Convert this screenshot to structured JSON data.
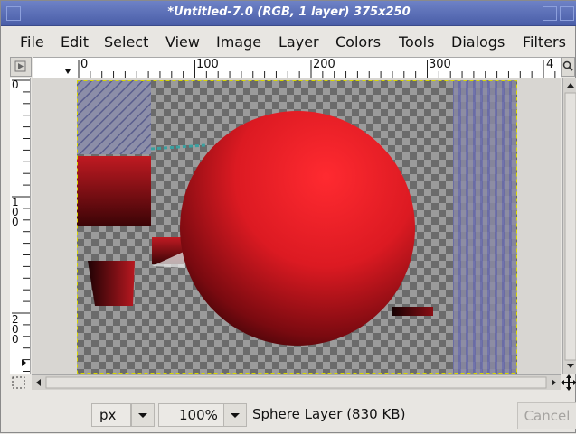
{
  "window": {
    "title": "*Untitled-7.0 (RGB, 1 layer) 375x250"
  },
  "menu": [
    "File",
    "Edit",
    "Select",
    "View",
    "Image",
    "Layer",
    "Colors",
    "Tools",
    "Dialogs",
    "Filters"
  ],
  "ruler": {
    "top_labels": [
      "0",
      "100",
      "200",
      "300",
      "4"
    ],
    "left_labels": [
      "0",
      "1\n0\n0",
      "2\n0\n0"
    ]
  },
  "status": {
    "unit": "px",
    "zoom": "100%",
    "message": "Sphere Layer (830 KB)",
    "cancel_label": "Cancel"
  },
  "icons": [
    "nav-menu-icon",
    "zoom-icon",
    "quick-mask-icon",
    "navigate-icon",
    "scroll-up-icon",
    "scroll-down-icon",
    "scroll-left-icon",
    "scroll-right-icon",
    "dropdown-arrow-icon"
  ],
  "colors": {
    "titlebar": "#5468b2",
    "sphere": "#e8202a",
    "checker_light": "#9c9c9c",
    "checker_dark": "#6a6a6a"
  }
}
